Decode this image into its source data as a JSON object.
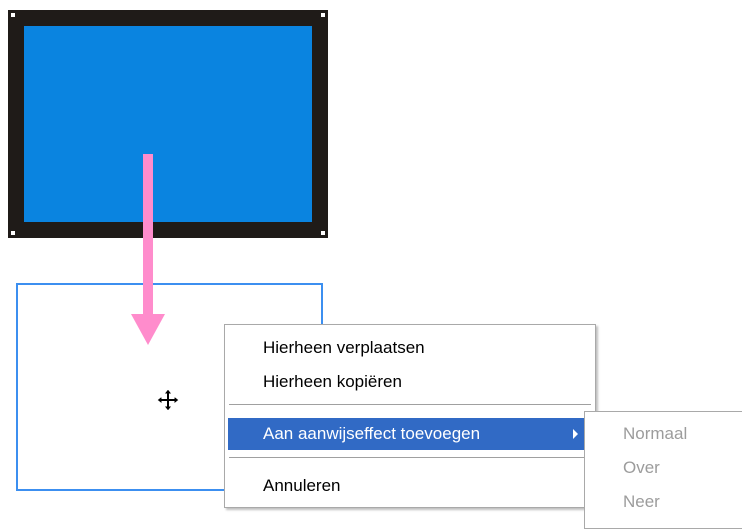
{
  "context_menu": {
    "items": [
      {
        "label": "Hierheen verplaatsen"
      },
      {
        "label": "Hierheen kopiëren"
      },
      {
        "label": "Aan aanwijseffect toevoegen",
        "highlighted": true,
        "has_submenu": true
      },
      {
        "label": "Annuleren"
      }
    ]
  },
  "submenu": {
    "items": [
      {
        "label": "Normaal",
        "disabled": true
      },
      {
        "label": "Over",
        "disabled": true
      },
      {
        "label": "Neer",
        "disabled": true
      }
    ]
  },
  "colors": {
    "object_fill": "#0a84e0",
    "object_border": "#1f1b18",
    "drop_outline": "#3c8ff0",
    "drag_arrow": "#ff8ccc",
    "menu_highlight": "#316ac5",
    "disabled_text": "#9c9c9c"
  },
  "icons": {
    "cursor": "move-cursor-icon",
    "submenu_indicator": "chevron-right-icon"
  }
}
